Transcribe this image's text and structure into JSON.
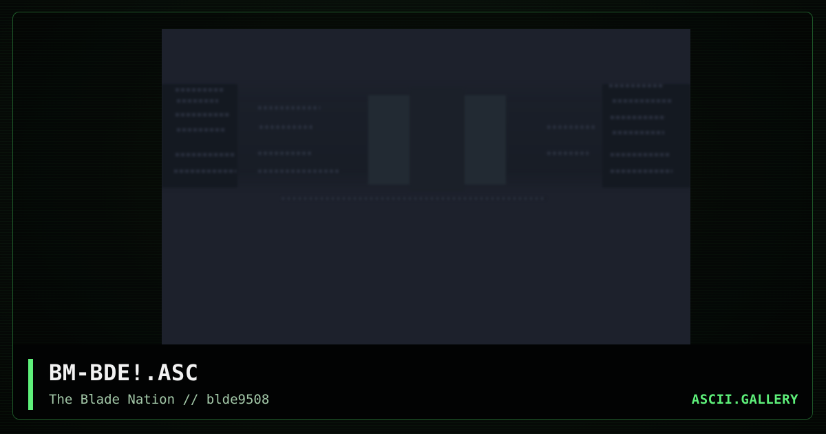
{
  "card": {
    "title": "BM-BDE!.ASC",
    "subtitle": "The Blade Nation // blde9508",
    "brand": "ASCII.GALLERY"
  },
  "colors": {
    "accent": "#5ef07a",
    "background": "#050806",
    "frame_border": "#1f5a2a",
    "preview_background": "#1d212c",
    "title_text": "#f2f2f2",
    "subtitle_text": "#a3c8a8"
  }
}
